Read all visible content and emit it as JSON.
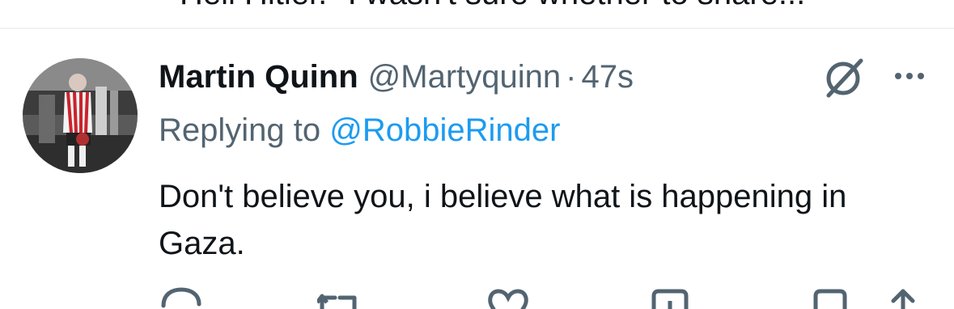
{
  "previous_tweet": {
    "visible_fragment": "Heil Hitler.\" I wasn't sure whether to share..."
  },
  "reply": {
    "author": {
      "display_name": "Martin Quinn",
      "handle": "@Martyquinn",
      "avatar": "avatar-photo"
    },
    "separator": "·",
    "timestamp": "47s",
    "replying_prefix": "Replying to",
    "replying_to": "@RobbieRinder",
    "text": "Don't believe you, i believe what is happening in Gaza."
  },
  "icons": {
    "grok": "grok-icon",
    "more": "more-icon",
    "reply": "reply-icon",
    "retweet": "retweet-icon",
    "like": "heart-icon",
    "views": "views-icon",
    "bookmark": "bookmark-icon",
    "share": "share-icon"
  },
  "colors": {
    "text": "#0f1419",
    "secondary": "#536471",
    "link": "#1d9bf0",
    "divider": "#eff3f4"
  }
}
